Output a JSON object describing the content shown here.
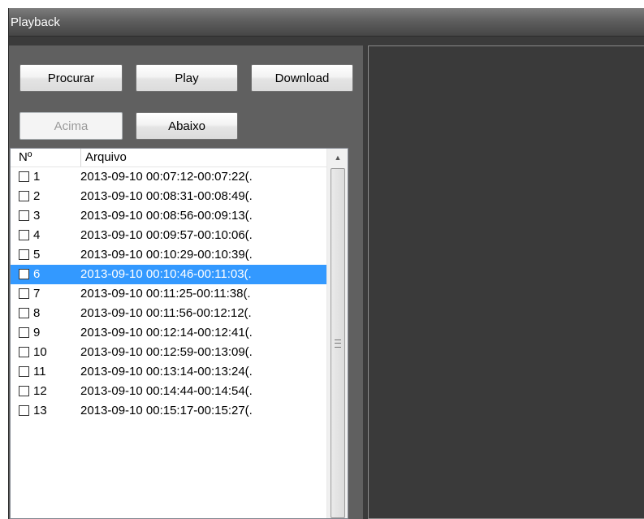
{
  "window": {
    "title": "Playback"
  },
  "toolbar": {
    "search_label": "Procurar",
    "play_label": "Play",
    "download_label": "Download",
    "up_label": "Acima",
    "down_label": "Abaixo"
  },
  "list": {
    "columns": {
      "number": "Nº",
      "file": "Arquivo"
    },
    "selected_index": 5,
    "rows": [
      {
        "num": "1",
        "file": "2013-09-10 00:07:12-00:07:22(."
      },
      {
        "num": "2",
        "file": "2013-09-10 00:08:31-00:08:49(."
      },
      {
        "num": "3",
        "file": "2013-09-10 00:08:56-00:09:13(."
      },
      {
        "num": "4",
        "file": "2013-09-10 00:09:57-00:10:06(."
      },
      {
        "num": "5",
        "file": "2013-09-10 00:10:29-00:10:39(."
      },
      {
        "num": "6",
        "file": "2013-09-10 00:10:46-00:11:03(."
      },
      {
        "num": "7",
        "file": "2013-09-10 00:11:25-00:11:38(."
      },
      {
        "num": "8",
        "file": "2013-09-10 00:11:56-00:12:12(."
      },
      {
        "num": "9",
        "file": "2013-09-10 00:12:14-00:12:41(."
      },
      {
        "num": "10",
        "file": "2013-09-10 00:12:59-00:13:09(."
      },
      {
        "num": "11",
        "file": "2013-09-10 00:13:14-00:13:24(."
      },
      {
        "num": "12",
        "file": "2013-09-10 00:14:44-00:14:54(."
      },
      {
        "num": "13",
        "file": "2013-09-10 00:15:17-00:15:27(."
      }
    ]
  },
  "icons": {
    "scroll_up": "chevron-up-icon",
    "scroll_grip": "grip-icon",
    "checkbox": "checkbox-icon"
  },
  "colors": {
    "selection": "#3399ff",
    "panel_bg": "#606060",
    "video_bg": "#3a3a3a"
  }
}
